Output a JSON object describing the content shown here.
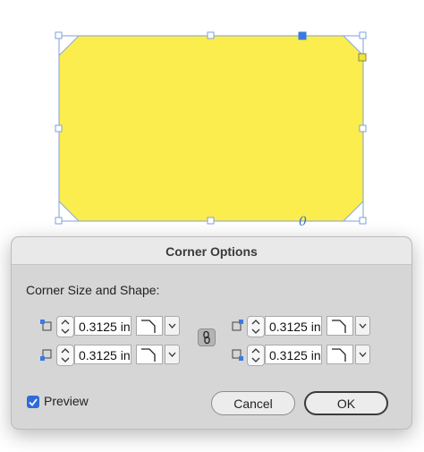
{
  "canvas": {
    "shape_fill": "#fbed4e",
    "selection_color": "#5b8fd8"
  },
  "dialog": {
    "title": "Corner Options",
    "section_label": "Corner Size and Shape:",
    "corners": [
      {
        "name": "top-left",
        "value": "0.3125 in",
        "shape": "bevel"
      },
      {
        "name": "bottom-left",
        "value": "0.3125 in",
        "shape": "bevel"
      },
      {
        "name": "top-right",
        "value": "0.3125 in",
        "shape": "bevel"
      },
      {
        "name": "bottom-right",
        "value": "0.3125 in",
        "shape": "bevel"
      }
    ],
    "link_icon": "chain-link-icon",
    "preview": {
      "label": "Preview",
      "checked": true
    },
    "cancel_label": "Cancel",
    "ok_label": "OK"
  },
  "colors": {
    "accent": "#2f6ad9",
    "dialog_bg": "#d6d6d6",
    "titlebar_bg": "#e9e9e9"
  }
}
